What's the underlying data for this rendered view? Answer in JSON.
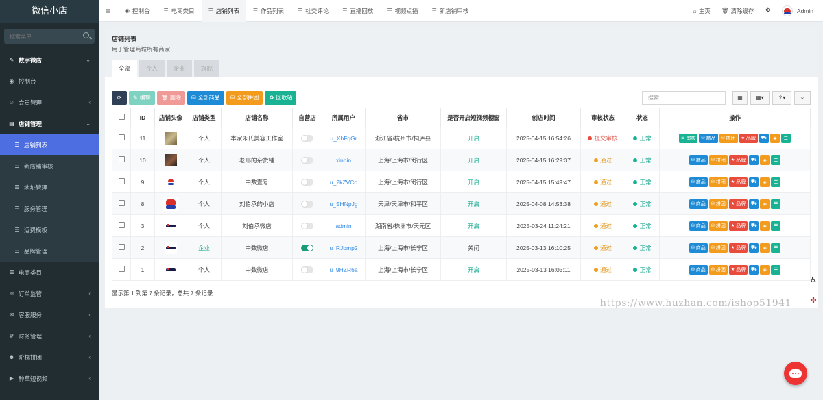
{
  "sidebar": {
    "brand": "微信小店",
    "search_placeholder": "搜索菜单",
    "items": [
      {
        "label": "数字微店",
        "icon": "✎",
        "icon_name": "magic-icon",
        "type": "group",
        "caret": "⌄"
      },
      {
        "label": "控制台",
        "icon": "◉",
        "icon_name": "dashboard-icon",
        "type": "item",
        "caret": ""
      },
      {
        "label": "会员管理",
        "icon": "☺",
        "icon_name": "user-icon",
        "type": "item",
        "caret": "‹"
      },
      {
        "label": "店铺管理",
        "icon": "▤",
        "icon_name": "shop-icon",
        "type": "group",
        "caret": "⌄"
      },
      {
        "label": "店铺列表",
        "icon": "☰",
        "icon_name": "list-icon",
        "type": "active",
        "caret": ""
      },
      {
        "label": "新店铺审核",
        "icon": "☰",
        "icon_name": "list-icon",
        "type": "sub",
        "caret": ""
      },
      {
        "label": "地址管理",
        "icon": "☰",
        "icon_name": "list-icon",
        "type": "sub",
        "caret": ""
      },
      {
        "label": "服务管理",
        "icon": "☰",
        "icon_name": "list-icon",
        "type": "sub",
        "caret": ""
      },
      {
        "label": "运费模板",
        "icon": "☰",
        "icon_name": "list-icon",
        "type": "sub",
        "caret": ""
      },
      {
        "label": "品牌管理",
        "icon": "☰",
        "icon_name": "list-icon",
        "type": "sub",
        "caret": ""
      },
      {
        "label": "电商类目",
        "icon": "☰",
        "icon_name": "list-icon",
        "type": "item",
        "caret": ""
      },
      {
        "label": "订单监管",
        "icon": "♒",
        "icon_name": "order-icon",
        "type": "item",
        "caret": "‹"
      },
      {
        "label": "客服服务",
        "icon": "✉",
        "icon_name": "chat-icon",
        "type": "item",
        "caret": "‹"
      },
      {
        "label": "财务管理",
        "icon": "₽",
        "icon_name": "finance-icon",
        "type": "item",
        "caret": "‹"
      },
      {
        "label": "阶梯拼团",
        "icon": "☻",
        "icon_name": "group-icon",
        "type": "item",
        "caret": "‹"
      },
      {
        "label": "种草短视频",
        "icon": "▶",
        "icon_name": "video-icon",
        "type": "item",
        "caret": "‹"
      }
    ]
  },
  "topbar": {
    "menu_icon": "≡",
    "tabs": [
      {
        "label": "控制台",
        "icon": "◉",
        "icon_name": "dashboard-icon",
        "active": false
      },
      {
        "label": "电商类目",
        "icon": "☰",
        "icon_name": "list-icon",
        "active": false
      },
      {
        "label": "店铺列表",
        "icon": "☰",
        "icon_name": "list-icon",
        "active": true
      },
      {
        "label": "作品列表",
        "icon": "☰",
        "icon_name": "list-icon",
        "active": false
      },
      {
        "label": "社交评论",
        "icon": "☰",
        "icon_name": "list-icon",
        "active": false
      },
      {
        "label": "直播回放",
        "icon": "☰",
        "icon_name": "list-icon",
        "active": false
      },
      {
        "label": "视频点播",
        "icon": "☰",
        "icon_name": "list-icon",
        "active": false
      },
      {
        "label": "新店铺审核",
        "icon": "☰",
        "icon_name": "list-icon",
        "active": false
      }
    ],
    "home": "主页",
    "clear_cache": "清除缓存",
    "fullscreen_icon": "✥",
    "user": "Admin"
  },
  "page": {
    "title": "店铺列表",
    "subtitle": "用于管理商城所有商家",
    "filter_tabs": [
      {
        "label": "全部",
        "active": true
      },
      {
        "label": "个人",
        "active": false
      },
      {
        "label": "企业",
        "active": false
      },
      {
        "label": "旗舰",
        "active": false
      }
    ],
    "toolbar": {
      "refresh_icon": "⟳",
      "edit": "编辑",
      "delete": "删除",
      "all_products": "全部商品",
      "all_group": "全部拼团",
      "recycle": "回收站",
      "search_placeholder": "搜索"
    },
    "columns": [
      "ID",
      "店铺头像",
      "店铺类型",
      "店铺名称",
      "自营店",
      "所属用户",
      "省市",
      "是否开启短视频橱窗",
      "创店时间",
      "审核状态",
      "状态",
      "操作"
    ],
    "rows": [
      {
        "id": "11",
        "avatar": "photo",
        "type": "个人",
        "type_link": false,
        "name": "本家禾氏美容工作室",
        "self": false,
        "user": "u_XhFqGr",
        "region": "浙江省/杭州市/桐庐县",
        "video": "开启",
        "video_on": true,
        "created": "2025-04-15 16:54:26",
        "audit": "提交审核",
        "audit_color": "red",
        "status": "正常",
        "audit_btn": true
      },
      {
        "id": "10",
        "avatar": "dark",
        "type": "个人",
        "type_link": false,
        "name": "老邢的杂货铺",
        "self": false,
        "user": "xinbin",
        "region": "上海/上海市/闵行区",
        "video": "开启",
        "video_on": true,
        "created": "2025-04-15 16:29:37",
        "audit": "通过",
        "audit_color": "orange",
        "status": "正常",
        "audit_btn": false
      },
      {
        "id": "9",
        "avatar": "logo",
        "type": "个人",
        "type_link": false,
        "name": "中数壹号",
        "self": false,
        "user": "u_2kZVCo",
        "region": "上海/上海市/闵行区",
        "video": "开启",
        "video_on": true,
        "created": "2025-04-15 15:49:47",
        "audit": "通过",
        "audit_color": "orange",
        "status": "正常",
        "audit_btn": false
      },
      {
        "id": "8",
        "avatar": "logo-big",
        "type": "个人",
        "type_link": false,
        "name": "刘伯承的小店",
        "self": false,
        "user": "u_SHNpJg",
        "region": "天津/天津市/和平区",
        "video": "开启",
        "video_on": true,
        "created": "2025-04-08 14:53:38",
        "audit": "通过",
        "audit_color": "orange",
        "status": "正常",
        "audit_btn": false
      },
      {
        "id": "3",
        "avatar": "bar",
        "type": "个人",
        "type_link": false,
        "name": "刘伯承微店",
        "self": false,
        "user": "admin",
        "region": "湖南省/株洲市/天元区",
        "video": "开启",
        "video_on": true,
        "created": "2025-03-24 11:24:21",
        "audit": "通过",
        "audit_color": "orange",
        "status": "正常",
        "audit_btn": false
      },
      {
        "id": "2",
        "avatar": "bar",
        "type": "企业",
        "type_link": true,
        "name": "中数微店",
        "self": true,
        "user": "u_RJbmp2",
        "region": "上海/上海市/长宁区",
        "video": "关闭",
        "video_on": false,
        "created": "2025-03-13 16:10:25",
        "audit": "通过",
        "audit_color": "orange",
        "status": "正常",
        "audit_btn": false
      },
      {
        "id": "1",
        "avatar": "bar",
        "type": "个人",
        "type_link": false,
        "name": "中数微店",
        "self": false,
        "user": "u_9HZR6a",
        "region": "上海/上海市/长宁区",
        "video": "开启",
        "video_on": true,
        "created": "2025-03-13 16:03:11",
        "audit": "通过",
        "audit_color": "orange",
        "status": "正常",
        "audit_btn": false
      }
    ],
    "op_labels": {
      "audit": "审核",
      "goods": "商品",
      "group": "拼团",
      "brand": "品牌"
    },
    "footer": "显示第 1 到第 7 条记录，总共 7 条记录"
  },
  "watermark": "https://www.huzhan.com/ishop51941",
  "colors": {
    "sidebar": "#222d32",
    "active": "#4c6ee0",
    "teal": "#19b394",
    "blue": "#1e8bd6",
    "orange": "#f29b1d",
    "red": "#e74c3c"
  }
}
